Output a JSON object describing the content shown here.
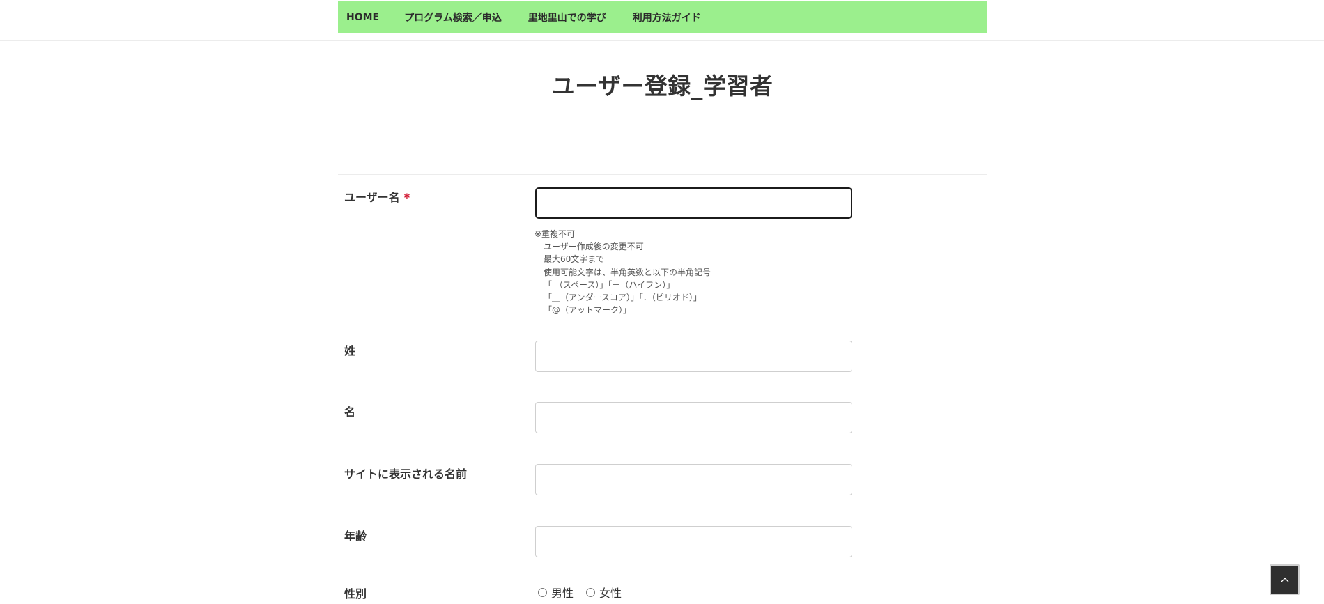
{
  "nav": {
    "items": [
      "HOME",
      "プログラム検索／申込",
      "里地里山での学び",
      "利用方法ガイド"
    ]
  },
  "page": {
    "title": "ユーザー登録_学習者"
  },
  "form": {
    "username": {
      "label": "ユーザー名",
      "required_mark": "*",
      "value": "",
      "help": [
        "※重複不可",
        "ユーザー作成後の変更不可",
        "最大60文字まで",
        "使用可能文字は、半角英数と以下の半角記号",
        "「 （スペース）」「－（ハイフン）」",
        "「＿（アンダースコア）」「．（ピリオド）」",
        "「@（アットマーク）」"
      ]
    },
    "last_name": {
      "label": "姓",
      "value": ""
    },
    "first_name": {
      "label": "名",
      "value": ""
    },
    "display_name": {
      "label": "サイトに表示される名前",
      "value": ""
    },
    "age": {
      "label": "年齢",
      "value": ""
    },
    "gender": {
      "label": "性別",
      "options": [
        "男性",
        "女性"
      ]
    }
  },
  "icons": {
    "back_to_top": "chevron-up-icon"
  }
}
